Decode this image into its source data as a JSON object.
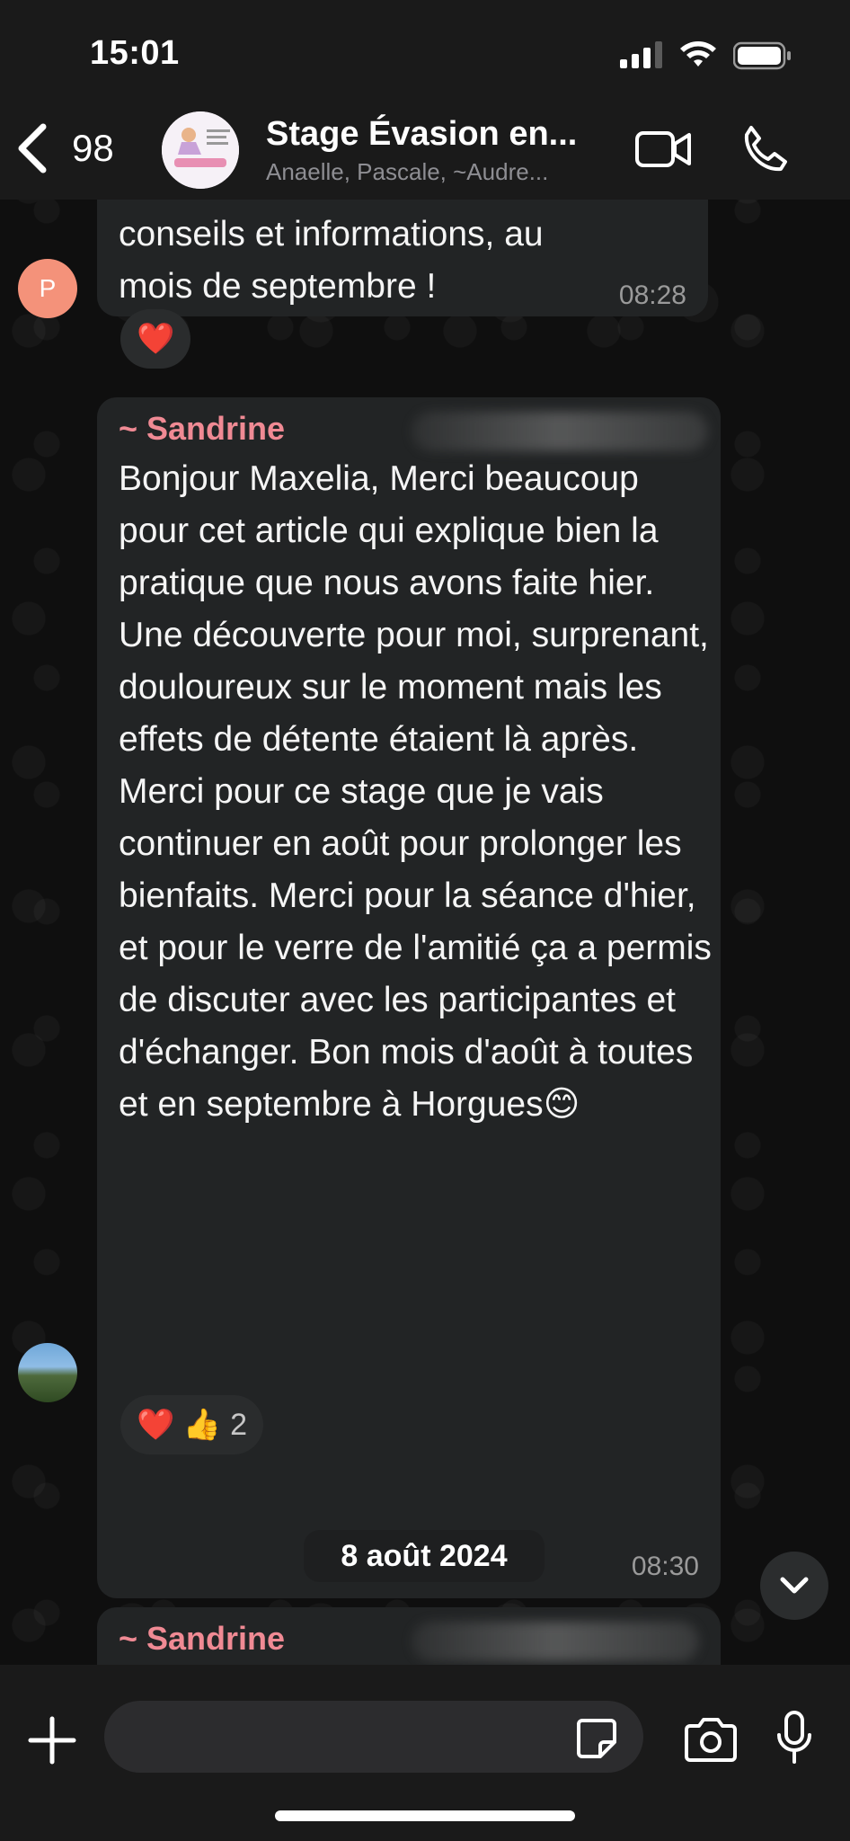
{
  "status_bar": {
    "time": "15:01"
  },
  "header": {
    "back_count": "98",
    "title": "Stage Évasion en...",
    "members": "Anaelle, Pascale, ~Audre..."
  },
  "messages": [
    {
      "text_lines": [
        "conseils et informations,  au",
        "mois de septembre !"
      ],
      "time": "08:28",
      "avatar_initial": "P",
      "reactions": {
        "emojis": "❤️",
        "count": ""
      }
    },
    {
      "sender": "~ Sandrine",
      "text": "Bonjour Maxelia, Merci beaucoup pour cet article qui explique bien la pratique que nous avons faite hier. Une découverte pour moi, surprenant, douloureux sur le moment mais les effets de détente étaient là après. Merci pour ce stage que je vais continuer en août pour prolonger les bienfaits. Merci pour la séance d'hier, et pour le verre de l'amitié ça a permis de discuter avec les participantes et d'échanger. Bon mois d'août à toutes et en septembre à Horgues😊",
      "time": "08:30",
      "reactions": {
        "emojis": "❤️ 👍",
        "count": "2"
      }
    },
    {
      "sender": "~ Sandrine"
    }
  ],
  "date_separator": "8 août 2024",
  "composer": {
    "placeholder": ""
  },
  "colors": {
    "sender": "#f08a94",
    "bubble": "#222425",
    "avatar_p": "#f4927a"
  }
}
